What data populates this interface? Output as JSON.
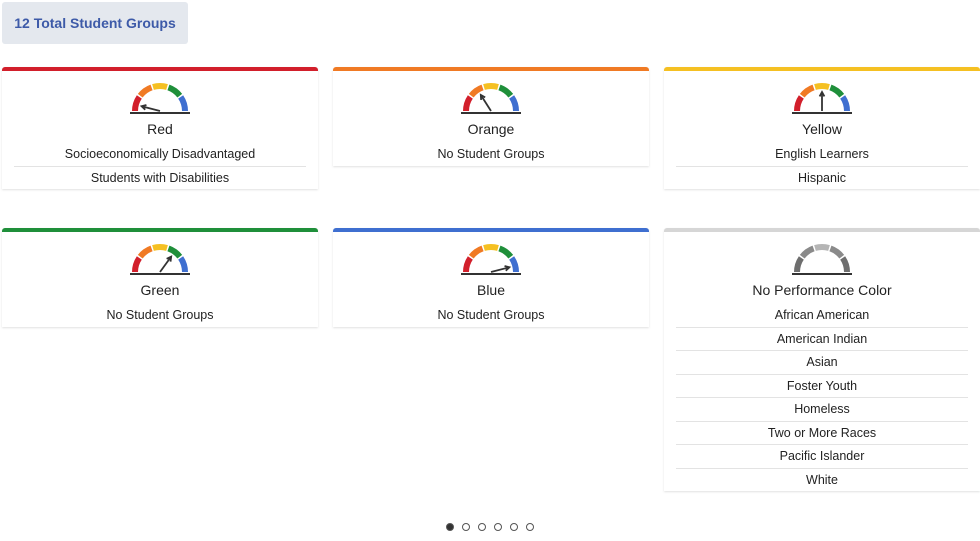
{
  "summary": {
    "total_label": "12 Total Student Groups"
  },
  "cards": [
    {
      "key": "red",
      "title": "Red",
      "accent": "#d21f2b",
      "needle_level": 0.08,
      "gray_gauge": false,
      "groups": [
        "Socioeconomically Disadvantaged",
        "Students with Disabilities"
      ]
    },
    {
      "key": "orange",
      "title": "Orange",
      "accent": "#f07a24",
      "needle_level": 0.32,
      "gray_gauge": false,
      "groups": [
        "No Student Groups"
      ]
    },
    {
      "key": "yellow",
      "title": "Yellow",
      "accent": "#f5c022",
      "needle_level": 0.5,
      "gray_gauge": false,
      "groups": [
        "English Learners",
        "Hispanic"
      ]
    },
    {
      "key": "green",
      "title": "Green",
      "accent": "#1f8f3a",
      "needle_level": 0.7,
      "gray_gauge": false,
      "groups": [
        "No Student Groups"
      ]
    },
    {
      "key": "blue",
      "title": "Blue",
      "accent": "#3f6fd0",
      "needle_level": 0.92,
      "gray_gauge": false,
      "groups": [
        "No Student Groups"
      ]
    },
    {
      "key": "none",
      "title": "No Performance Color",
      "accent": "#d6d6d6",
      "needle_level": null,
      "gray_gauge": true,
      "groups": [
        "African American",
        "American Indian",
        "Asian",
        "Foster Youth",
        "Homeless",
        "Two or More Races",
        "Pacific Islander",
        "White"
      ]
    }
  ],
  "gauge_colors": [
    "#d21f2b",
    "#f07a24",
    "#f5c022",
    "#1f8f3a",
    "#3f6fd0"
  ],
  "gauge_gray_colors": [
    "#6e6e6e",
    "#8a8a8a",
    "#b5b5b5",
    "#8a8a8a",
    "#6e6e6e"
  ],
  "pager": {
    "count": 6,
    "active_index": 0
  }
}
